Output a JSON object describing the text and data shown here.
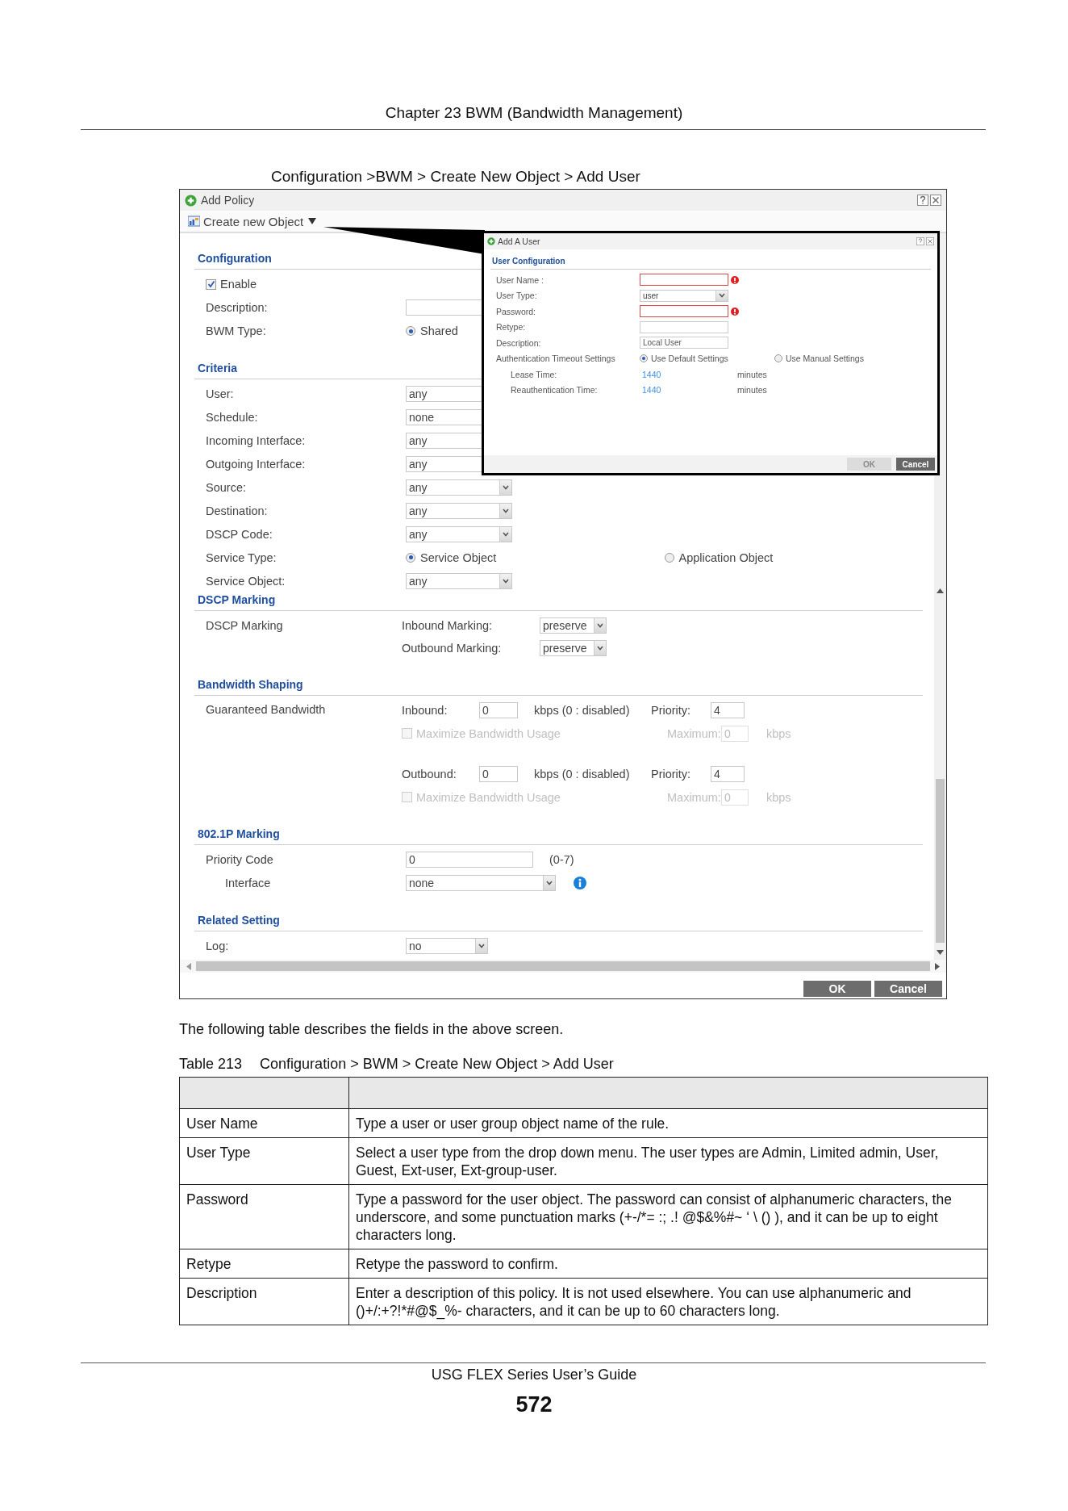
{
  "header": {
    "chapter": "Chapter 23 BWM (Bandwidth Management)"
  },
  "figure_caption": "Configuration >BWM > Create New Object > Add User",
  "dialog": {
    "title": "Add Policy",
    "toolbar_item": "Create new Object",
    "sections": [
      {
        "heading": "Configuration",
        "rows": [
          {
            "kind": "checkbox",
            "label": "Enable",
            "checked": true
          },
          {
            "kind": "text",
            "label": "Description:"
          },
          {
            "kind": "radio",
            "label": "BWM Type:",
            "options": [
              {
                "label": "Shared",
                "selected": true
              }
            ]
          }
        ]
      },
      {
        "heading": "Criteria",
        "rows": [
          {
            "kind": "select-partial",
            "label": "User:",
            "value": "any"
          },
          {
            "kind": "select-partial",
            "label": "Schedule:",
            "value": "none"
          },
          {
            "kind": "select-partial",
            "label": "Incoming Interface:",
            "value": "any"
          },
          {
            "kind": "select-partial",
            "label": "Outgoing Interface:",
            "value": "any"
          },
          {
            "kind": "select",
            "label": "Source:",
            "value": "any"
          },
          {
            "kind": "select",
            "label": "Destination:",
            "value": "any"
          },
          {
            "kind": "select",
            "label": "DSCP Code:",
            "value": "any"
          },
          {
            "kind": "radio",
            "label": "Service Type:",
            "options": [
              {
                "label": "Service Object",
                "selected": true
              },
              {
                "label": "Application Object",
                "selected": false
              }
            ]
          },
          {
            "kind": "select",
            "label": "Service Object:",
            "value": "any"
          }
        ]
      },
      {
        "heading": "DSCP Marking",
        "rows": [
          {
            "kind": "pair",
            "label": "DSCP Marking",
            "items": [
              {
                "label": "Inbound Marking:",
                "value": "preserve"
              },
              {
                "label": "Outbound Marking:",
                "value": "preserve"
              }
            ]
          }
        ]
      },
      {
        "heading": "Bandwidth Shaping",
        "rows": [
          {
            "kind": "bandwidth",
            "label": "Guaranteed Bandwidth",
            "directions": [
              {
                "label": "Inbound:",
                "value": "0",
                "unit": "kbps (0 : disabled)",
                "priority_label": "Priority:",
                "priority": "4",
                "maximize_label": "Maximize Bandwidth Usage",
                "maximize_checked": false,
                "maximize_disabled": true,
                "maximum_label": "Maximum:",
                "maximum": "0",
                "maximum_unit": "kbps"
              },
              {
                "label": "Outbound:",
                "value": "0",
                "unit": "kbps (0 : disabled)",
                "priority_label": "Priority:",
                "priority": "4",
                "maximize_label": "Maximize Bandwidth Usage",
                "maximize_checked": false,
                "maximize_disabled": true,
                "maximum_label": "Maximum:",
                "maximum": "0",
                "maximum_unit": "kbps"
              }
            ]
          }
        ]
      },
      {
        "heading": "802.1P Marking",
        "rows": [
          {
            "kind": "input",
            "label": "Priority Code",
            "value": "0",
            "hint": "(0-7)"
          },
          {
            "kind": "select-info",
            "label": "Interface",
            "value": "none"
          }
        ]
      },
      {
        "heading": "Related Setting",
        "rows": [
          {
            "kind": "select-short",
            "label": "Log:",
            "value": "no"
          }
        ]
      }
    ],
    "buttons": [
      {
        "label": "OK"
      },
      {
        "label": "Cancel"
      }
    ]
  },
  "popup": {
    "title": "Add A User",
    "heading": "User Configuration",
    "rows": [
      {
        "kind": "input",
        "label": "User Name :",
        "required": true
      },
      {
        "kind": "select",
        "label": "User Type:",
        "value": "user"
      },
      {
        "kind": "input",
        "label": "Password:",
        "required": true
      },
      {
        "kind": "input",
        "label": "Retype:",
        "required": false
      },
      {
        "kind": "input",
        "label": "Description:",
        "value": "Local User",
        "required": false
      },
      {
        "kind": "radio",
        "label": "Authentication Timeout Settings",
        "options": [
          {
            "label": "Use Default Settings",
            "selected": true
          },
          {
            "label": "Use Manual Settings",
            "selected": false
          }
        ]
      },
      {
        "kind": "value",
        "label": "Lease Time:",
        "value": "1440",
        "unit": "minutes"
      },
      {
        "kind": "value",
        "label": "Reauthentication Time:",
        "value": "1440",
        "unit": "minutes"
      }
    ],
    "buttons": [
      {
        "label": "OK",
        "disabled": true
      },
      {
        "label": "Cancel",
        "disabled": false
      }
    ]
  },
  "intro": "The following table describes the fields in the above screen.",
  "table": {
    "number": "Table 213",
    "caption": "Configuration > BWM > Create New Object > Add User",
    "rows": [
      {
        "label": "User Name",
        "description": "Type a user or user group object name of the rule."
      },
      {
        "label": "User Type",
        "description": "Select a user type from the drop down menu. The user types are Admin, Limited admin, User, Guest, Ext-user, Ext-group-user."
      },
      {
        "label": "Password",
        "description": "Type a password for the user object. The password can consist of alphanumeric characters, the underscore, and some punctuation marks (+-/*= :; .! @$&%#~ ‘ \\ () ), and it can be up to eight characters long."
      },
      {
        "label": "Retype",
        "description": "Retype the password to confirm."
      },
      {
        "label": "Description",
        "description": "Enter a description of this policy. It is not used elsewhere. You can use alphanumeric and ()+/:+?!*#@$_%- characters, and it can be up to 60 characters long."
      }
    ]
  },
  "footer": {
    "guide": "USG FLEX Series User’s Guide",
    "page": "572"
  }
}
